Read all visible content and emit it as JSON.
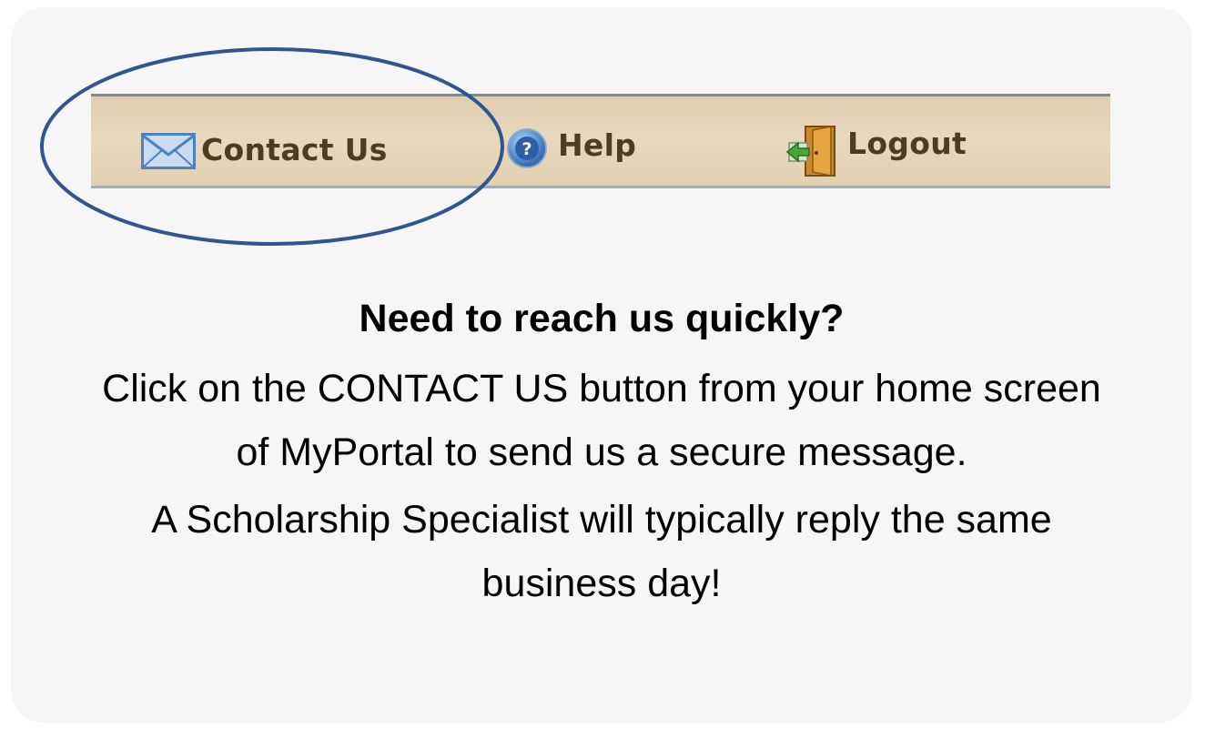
{
  "nav": {
    "items": [
      {
        "label": "Contact Us",
        "icon": "envelope-icon"
      },
      {
        "label": "Help",
        "icon": "help-icon"
      },
      {
        "label": "Logout",
        "icon": "logout-door-icon"
      }
    ],
    "highlighted": "Contact Us"
  },
  "message": {
    "heading": "Need to reach us quickly?",
    "paragraph_1": "Click on the CONTACT US button from your home screen of MyPortal to send us a secure message.",
    "paragraph_2": "A Scholarship Specialist will typically reply the same business day!"
  },
  "colors": {
    "nav_background": "#e5d3b6",
    "nav_text": "#4f3b24",
    "highlight_ring": "#2f5592",
    "card_background": "#f6f6f6"
  }
}
